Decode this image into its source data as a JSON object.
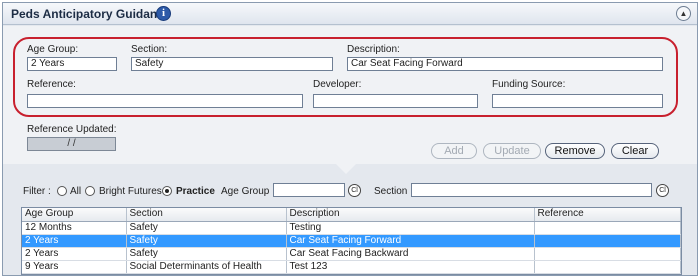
{
  "header": {
    "title": "Peds Anticipatory Guidance",
    "info_icon": "i",
    "collapse_icon": "▲"
  },
  "form": {
    "age_group": {
      "label": "Age Group:",
      "value": "2 Years"
    },
    "section": {
      "label": "Section:",
      "value": "Safety"
    },
    "description": {
      "label": "Description:",
      "value": "Car Seat Facing Forward"
    },
    "reference": {
      "label": "Reference:",
      "value": ""
    },
    "developer": {
      "label": "Developer:",
      "value": ""
    },
    "funding_source": {
      "label": "Funding Source:",
      "value": ""
    },
    "reference_updated": {
      "label": "Reference Updated:",
      "value": "/ /"
    }
  },
  "buttons": {
    "add": "Add",
    "update": "Update",
    "remove": "Remove",
    "clear": "Clear"
  },
  "filter": {
    "label": "Filter :",
    "options": [
      "All",
      "Bright Futures",
      "Practice"
    ],
    "selected": "Practice",
    "age_group_label": "Age Group :",
    "age_group_value": "",
    "section_label": "Section :",
    "section_value": "",
    "clear_icon": "Cl"
  },
  "table": {
    "columns": [
      "Age Group",
      "Section",
      "Description",
      "Reference"
    ],
    "rows": [
      [
        "12 Months",
        "Safety",
        "Testing",
        ""
      ],
      [
        "2 Years",
        "Safety",
        "Car Seat Facing Forward",
        ""
      ],
      [
        "2 Years",
        "Safety",
        "Car Seat Facing Backward",
        ""
      ],
      [
        "9 Years",
        "Social Determinants of Health",
        "Test 123",
        ""
      ]
    ],
    "selected_row": 1
  },
  "colors": {
    "highlight_outline": "#c8202e",
    "selected_row": "#3399ff",
    "info_icon": "#2d5aa8"
  }
}
